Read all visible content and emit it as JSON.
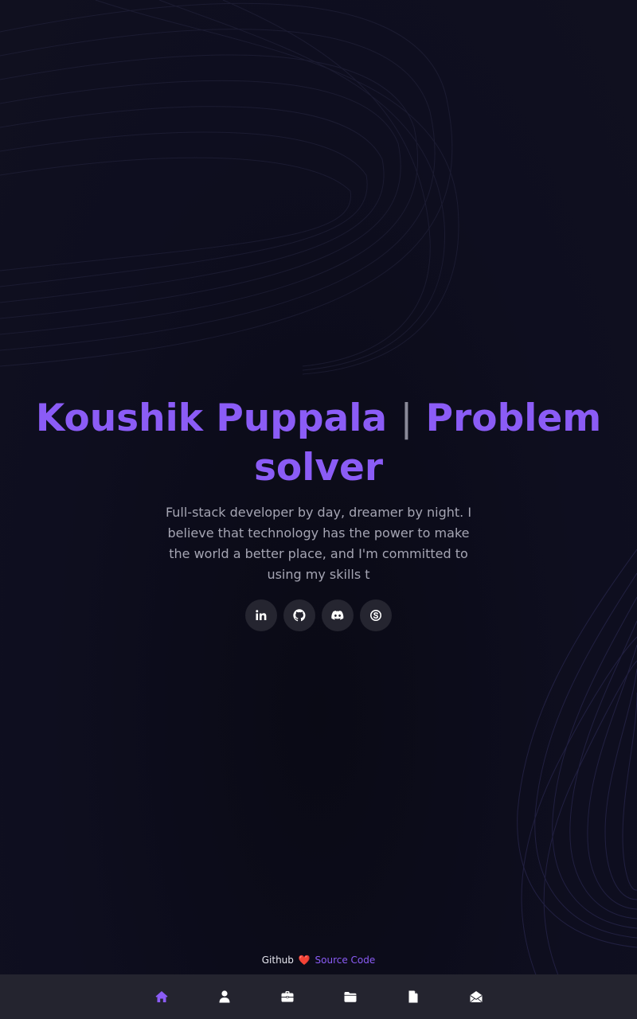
{
  "hero": {
    "name": "Koushik Puppala",
    "separator": "|",
    "role": "Problem solver",
    "description": "Full-stack developer by day, dreamer by night. I believe that technology has the power to make the world a better place, and I'm committed to using my skills t"
  },
  "socials": [
    {
      "icon": "linkedin-icon"
    },
    {
      "icon": "github-icon"
    },
    {
      "icon": "discord-icon"
    },
    {
      "icon": "skype-icon"
    }
  ],
  "footer": {
    "prefix": "Github",
    "heart": "❤️",
    "link_label": "Source Code"
  },
  "nav": {
    "items": [
      {
        "icon": "home-icon",
        "active": true
      },
      {
        "icon": "user-icon",
        "active": false
      },
      {
        "icon": "briefcase-icon",
        "active": false
      },
      {
        "icon": "folder-icon",
        "active": false
      },
      {
        "icon": "file-icon",
        "active": false
      },
      {
        "icon": "envelope-open-icon",
        "active": false
      }
    ]
  },
  "colors": {
    "accent": "#8b5cf6",
    "background": "#0d0d1b",
    "nav_background": "#24242f",
    "text_muted": "#a5a5b3"
  }
}
